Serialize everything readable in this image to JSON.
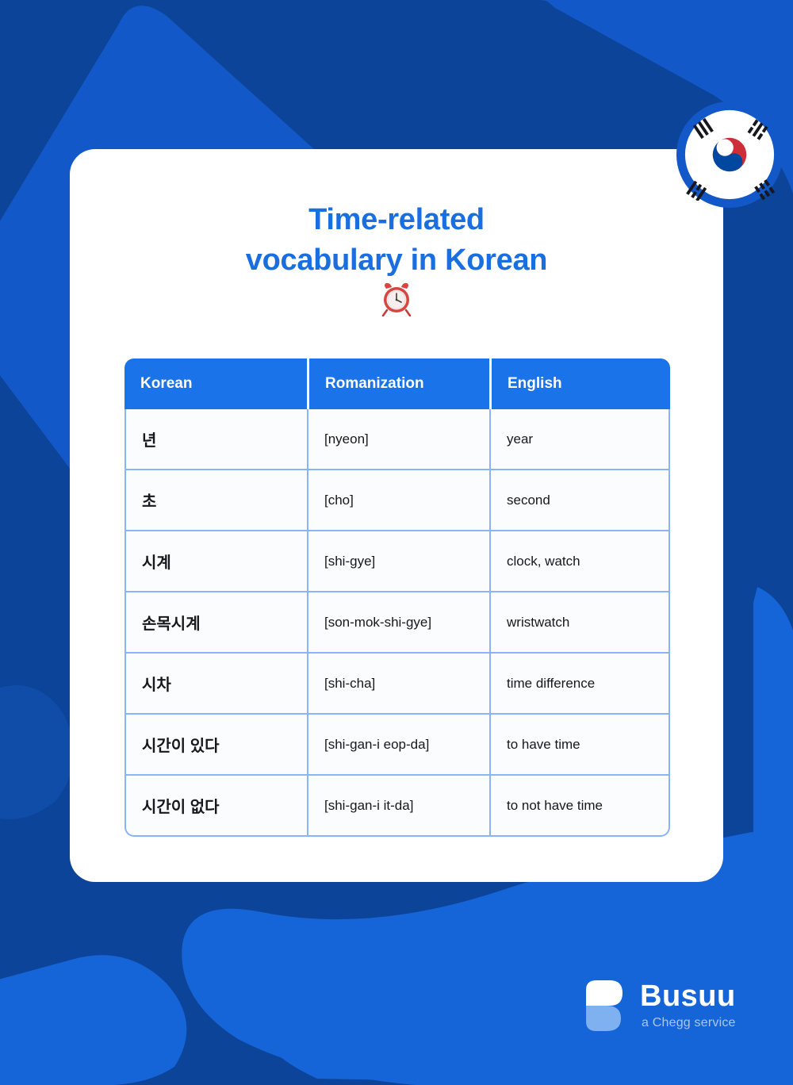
{
  "header": {
    "title_line_1": "Time-related",
    "title_line_2": "vocabulary in Korean",
    "emoji_name": "alarm-clock-icon",
    "flag_name": "south-korea-flag-icon"
  },
  "table": {
    "columns": [
      "Korean",
      "Romanization",
      "English"
    ],
    "rows": [
      {
        "korean": "년",
        "romanization": "[nyeon]",
        "english": "year"
      },
      {
        "korean": "초",
        "romanization": "[cho]",
        "english": "second"
      },
      {
        "korean": "시계",
        "romanization": "[shi-gye]",
        "english": "clock, watch"
      },
      {
        "korean": "손목시계",
        "romanization": "[son-mok-shi-gye]",
        "english": "wristwatch"
      },
      {
        "korean": "시차",
        "romanization": "[shi-cha]",
        "english": "time difference"
      },
      {
        "korean": "시간이 있다",
        "romanization": "[shi-gan-i eop-da]",
        "english": "to have time"
      },
      {
        "korean": "시간이 없다",
        "romanization": "[shi-gan-i it-da]",
        "english": "to not have time"
      }
    ]
  },
  "logo": {
    "wordmark": "Busuu",
    "tagline": "a Chegg service"
  },
  "colors": {
    "background_navy": "#0c4499",
    "blob_blue": "#1358c8",
    "blob_bright": "#1565d8",
    "card_white": "#ffffff",
    "title_blue": "#1a6fe0",
    "table_header_blue": "#1a73e8",
    "table_border_blue": "#8ab4f8",
    "logo_tagline_blue": "#a8c8f0",
    "flag_red": "#cd2e3a",
    "flag_blue": "#0047a0"
  }
}
